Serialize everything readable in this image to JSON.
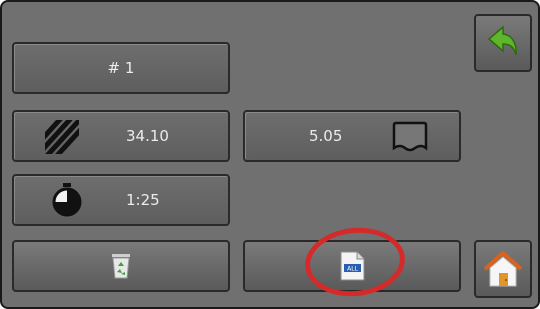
{
  "field": {
    "label": "# 1"
  },
  "area": {
    "value": "34.10",
    "icon": "hatched-area-icon"
  },
  "volume": {
    "value": "5.05",
    "icon": "tank-icon"
  },
  "time": {
    "value": "1:25",
    "icon": "stopwatch-icon"
  },
  "actions": {
    "delete_icon": "recycle-bin-icon",
    "report_icon": "file-icon",
    "report_file_label": "ALL",
    "back_icon": "back-arrow-icon",
    "home_icon": "home-icon"
  },
  "colors": {
    "background": "#707070",
    "button": "#666666",
    "text": "#ececec",
    "highlight": "#d42a2a",
    "back_arrow": "#5fb62a"
  }
}
